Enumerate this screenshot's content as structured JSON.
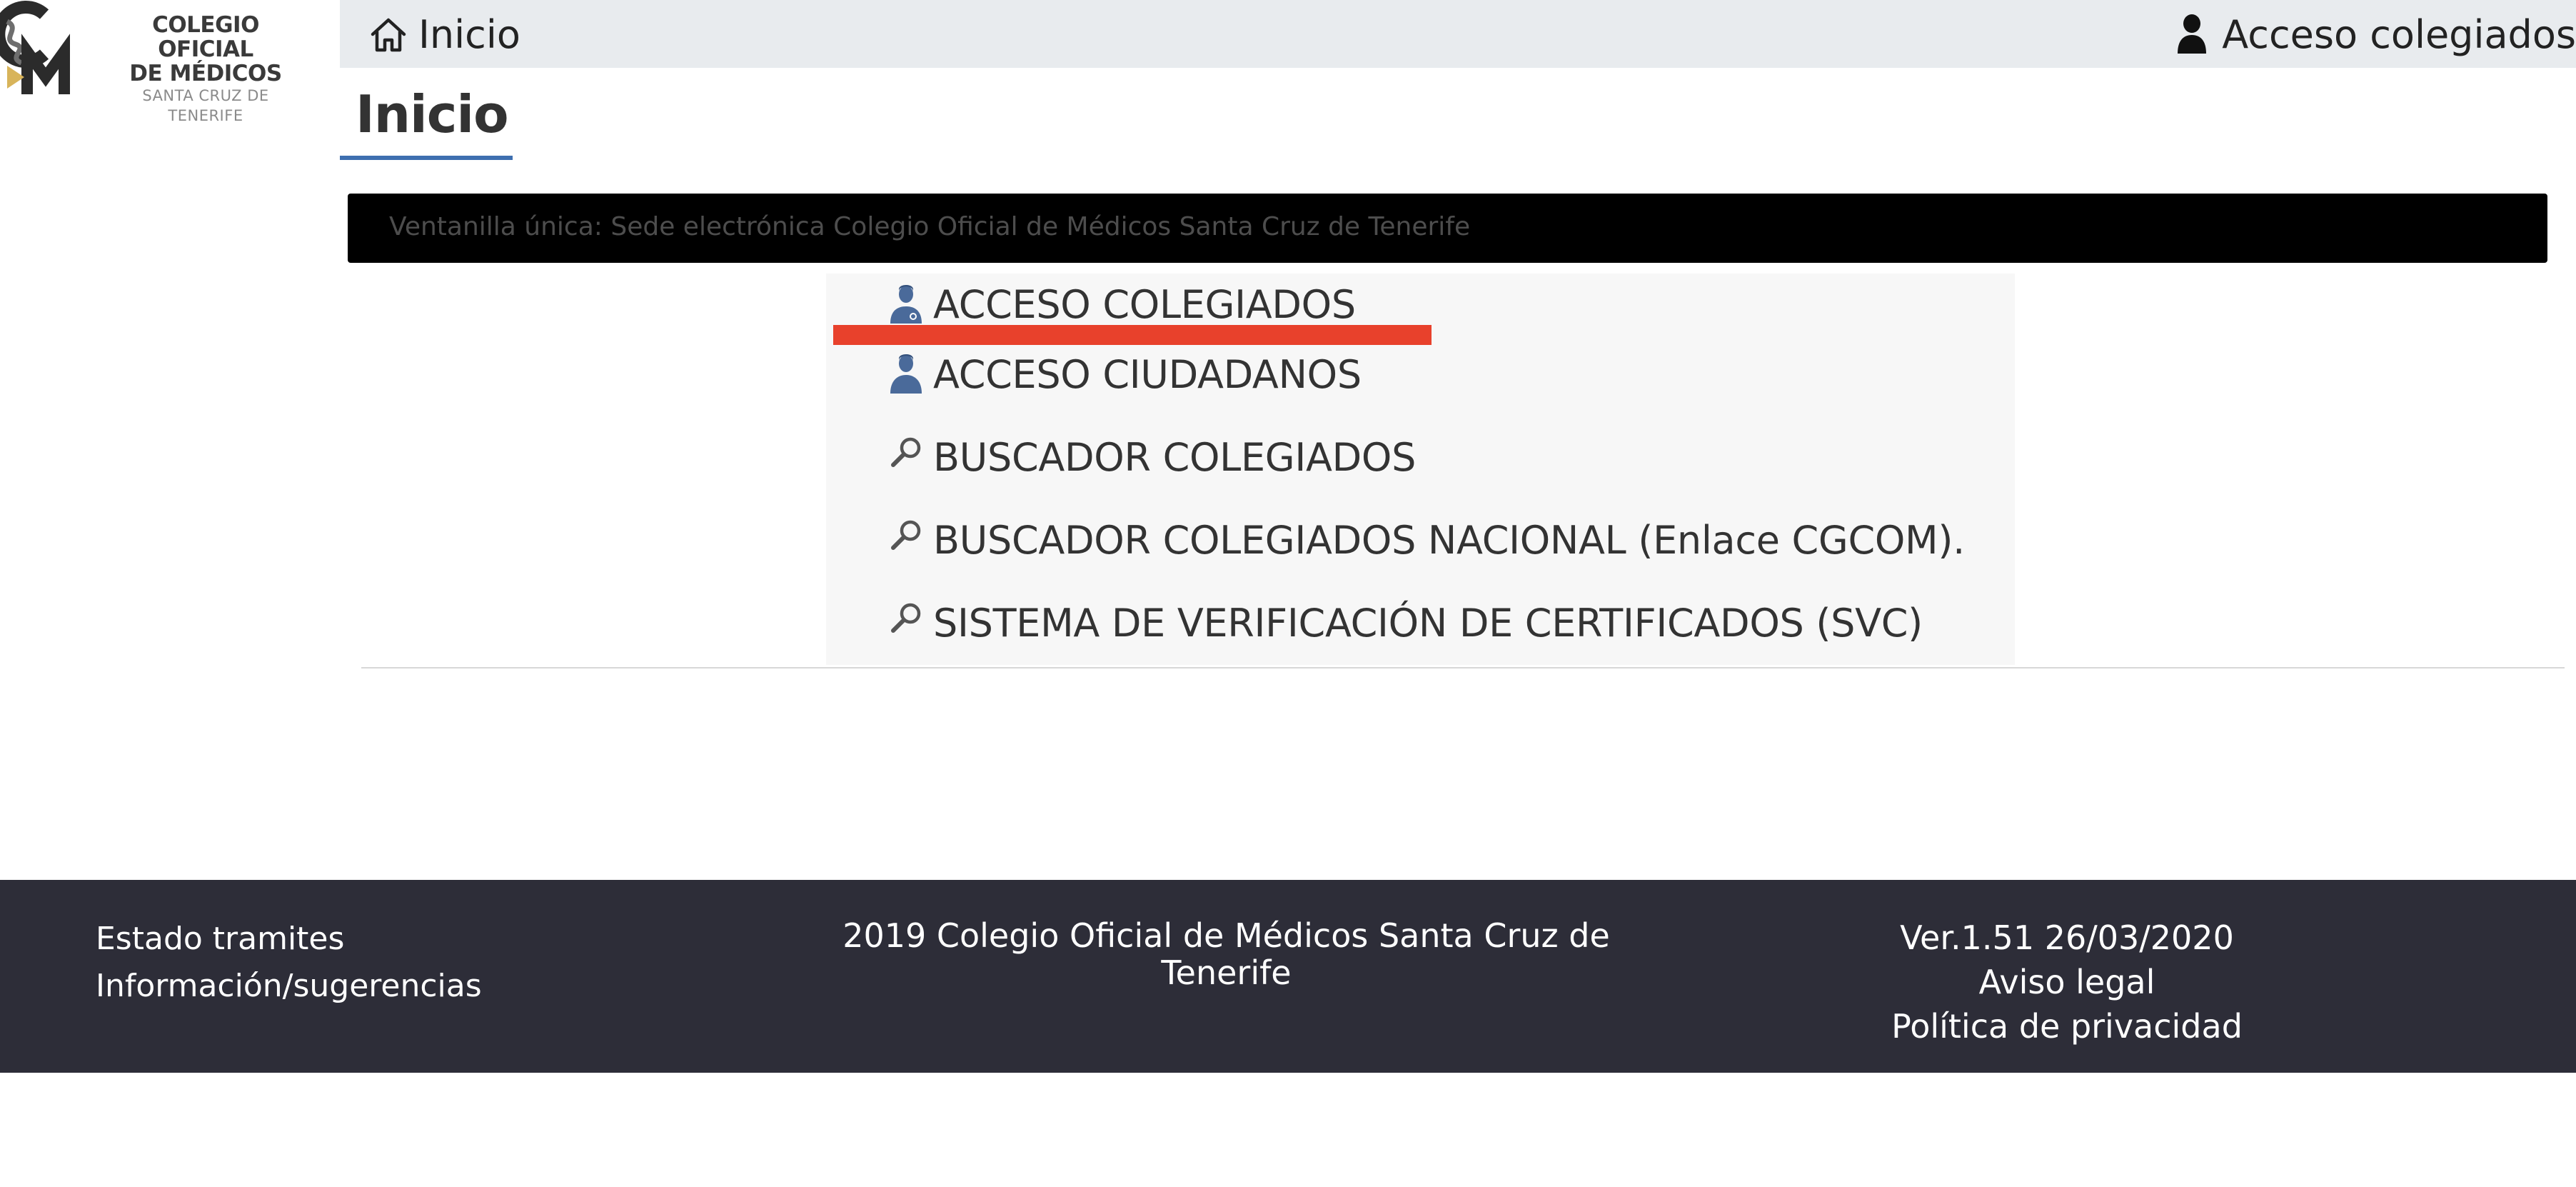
{
  "logo": {
    "line1": "COLEGIO OFICIAL",
    "line2": "DE MÉDICOS",
    "line3": "SANTA CRUZ DE TENERIFE",
    "colors": {
      "dark": "#2b2b2b",
      "accent": "#d8b45a"
    }
  },
  "topbar": {
    "home_label": "Inicio",
    "home_icon": "home-icon",
    "access_label": "Acceso colegiados",
    "access_icon": "user-icon"
  },
  "page": {
    "title": "Inicio"
  },
  "banner": {
    "text": "Ventanilla única: Sede electrónica Colegio Oficial de Médicos Santa Cruz de Tenerife"
  },
  "menu": {
    "items": [
      {
        "label": "ACCESO COLEGIADOS",
        "icon": "doctor-icon"
      },
      {
        "label": "ACCESO CIUDADANOS",
        "icon": "citizen-icon"
      },
      {
        "label": "BUSCADOR COLEGIADOS",
        "icon": "search-icon"
      },
      {
        "label": "BUSCADOR COLEGIADOS NACIONAL (Enlace CGCOM).",
        "icon": "search-icon"
      },
      {
        "label": "SISTEMA DE VERIFICACIÓN DE CERTIFICADOS (SVC)",
        "icon": "search-icon"
      }
    ],
    "highlight_color": "#e8412c"
  },
  "footer": {
    "left": {
      "link1": "Estado tramites",
      "link2": "Información/sugerencias"
    },
    "center": {
      "line1": "2019 Colegio Oficial de Médicos Santa Cruz de",
      "line2": "Tenerife"
    },
    "right": {
      "version": "Ver.1.51 26/03/2020",
      "legal": "Aviso legal",
      "privacy": "Política de privacidad"
    }
  }
}
